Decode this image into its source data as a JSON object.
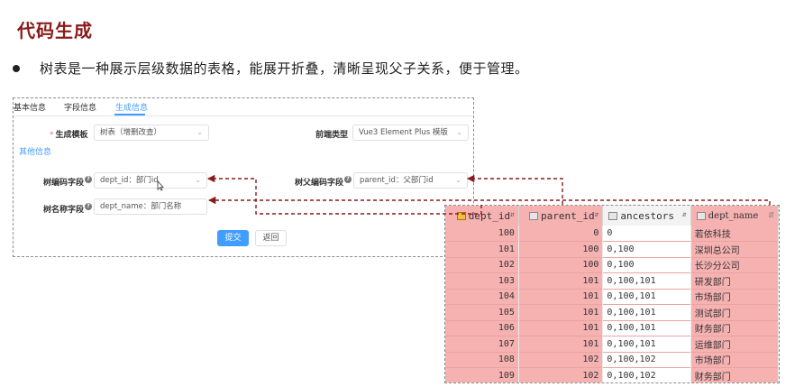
{
  "slide": {
    "title": "代码生成",
    "bullet": "树表是一种展示层级数据的表格，能展开折叠，清晰呈现父子关系，便于管理。"
  },
  "form": {
    "tabs": [
      {
        "label": "基本信息"
      },
      {
        "label": "字段信息"
      },
      {
        "label": "生成信息"
      }
    ],
    "template_label": "生成模板",
    "template_value": "树表（增删改查）",
    "frontend_label": "前端类型",
    "frontend_value": "Vue3 Element Plus 模版",
    "section_other": "其他信息",
    "tree_code_label": "树编码字段",
    "tree_code_value": "dept_id：部门id",
    "tree_parent_label": "树父编码字段",
    "tree_parent_value": "parent_id：父部门id",
    "tree_name_label": "树名称字段",
    "tree_name_value": "dept_name：部门名称",
    "submit_label": "提交",
    "back_label": "返回"
  },
  "table": {
    "columns": [
      "dept_id",
      "parent_id",
      "ancestors",
      "dept_name"
    ],
    "rows": [
      {
        "dept_id": "100",
        "parent_id": "0",
        "ancestors": "0",
        "dept_name": "若依科技"
      },
      {
        "dept_id": "101",
        "parent_id": "100",
        "ancestors": "0,100",
        "dept_name": "深圳总公司"
      },
      {
        "dept_id": "102",
        "parent_id": "100",
        "ancestors": "0,100",
        "dept_name": "长沙分公司"
      },
      {
        "dept_id": "103",
        "parent_id": "101",
        "ancestors": "0,100,101",
        "dept_name": "研发部门"
      },
      {
        "dept_id": "104",
        "parent_id": "101",
        "ancestors": "0,100,101",
        "dept_name": "市场部门"
      },
      {
        "dept_id": "105",
        "parent_id": "101",
        "ancestors": "0,100,101",
        "dept_name": "测试部门"
      },
      {
        "dept_id": "106",
        "parent_id": "101",
        "ancestors": "0,100,101",
        "dept_name": "财务部门"
      },
      {
        "dept_id": "107",
        "parent_id": "101",
        "ancestors": "0,100,101",
        "dept_name": "运维部门"
      },
      {
        "dept_id": "108",
        "parent_id": "102",
        "ancestors": "0,100,102",
        "dept_name": "市场部门"
      },
      {
        "dept_id": "109",
        "parent_id": "102",
        "ancestors": "0,100,102",
        "dept_name": "财务部门"
      }
    ]
  },
  "colors": {
    "title": "#8b1a1a",
    "accent": "#409eff",
    "highlight": "#f6b1b1",
    "arrow": "#8b1a1a"
  }
}
